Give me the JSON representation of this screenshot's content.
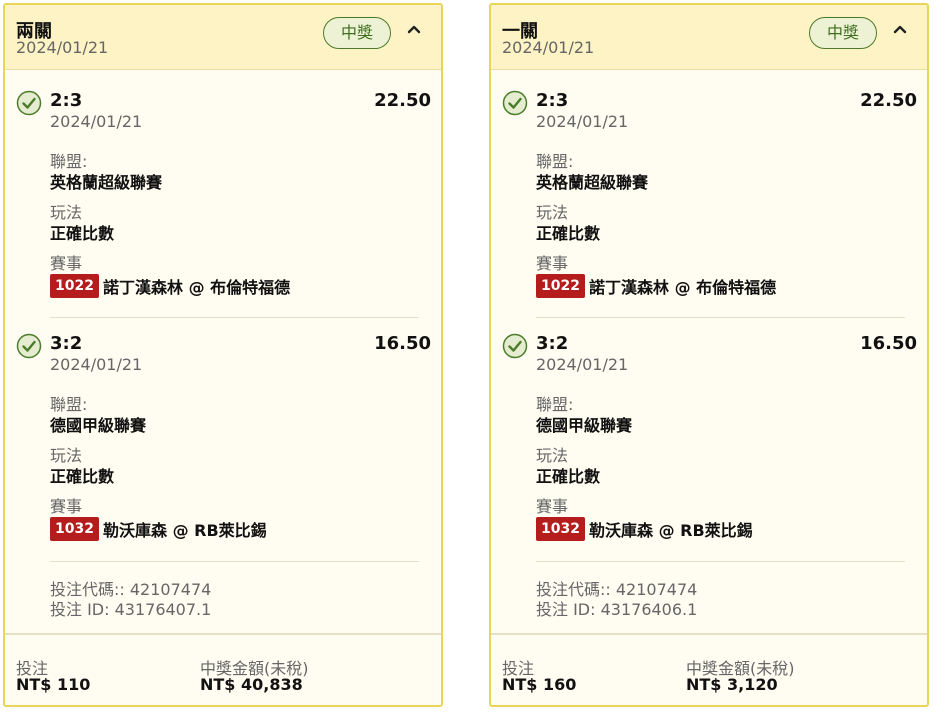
{
  "colors": {
    "header_bg": "#fdf3c4",
    "card_bg": "#fffdf2",
    "card_border": "#e8d55a",
    "win_badge_border": "#4c7a2a",
    "check_green": "#4a7d2a",
    "event_code_bg": "#b51c1c"
  },
  "bets": [
    {
      "title": "兩關",
      "date": "2024/01/21",
      "status": "中獎",
      "collapse_icon": "chevron-up-icon",
      "legs": [
        {
          "score": "2:3",
          "odds": "22.50",
          "date": "2024/01/21",
          "league_label": "聯盟:",
          "league": "英格蘭超級聯賽",
          "play_label": "玩法",
          "play": "正確比數",
          "event_label": "賽事",
          "event_code": "1022",
          "event_name": "諾丁漢森林 @ 布倫特福德"
        },
        {
          "score": "3:2",
          "odds": "16.50",
          "date": "2024/01/21",
          "league_label": "聯盟:",
          "league": "德國甲級聯賽",
          "play_label": "玩法",
          "play": "正確比數",
          "event_label": "賽事",
          "event_code": "1032",
          "event_name": "勒沃庫森 @ RB萊比錫"
        }
      ],
      "bet_code": "投注代碼:: 42107474",
      "bet_id": "投注 ID: 43176407.1",
      "stake_label": "投注",
      "stake": "NT$ 110",
      "payout_label": "中獎金額(未稅)",
      "payout": "NT$ 40,838"
    },
    {
      "title": "一關",
      "date": "2024/01/21",
      "status": "中獎",
      "collapse_icon": "chevron-up-icon",
      "legs": [
        {
          "score": "2:3",
          "odds": "22.50",
          "date": "2024/01/21",
          "league_label": "聯盟:",
          "league": "英格蘭超級聯賽",
          "play_label": "玩法",
          "play": "正確比數",
          "event_label": "賽事",
          "event_code": "1022",
          "event_name": "諾丁漢森林 @ 布倫特福德"
        },
        {
          "score": "3:2",
          "odds": "16.50",
          "date": "2024/01/21",
          "league_label": "聯盟:",
          "league": "德國甲級聯賽",
          "play_label": "玩法",
          "play": "正確比數",
          "event_label": "賽事",
          "event_code": "1032",
          "event_name": "勒沃庫森 @ RB萊比錫"
        }
      ],
      "bet_code": "投注代碼:: 42107474",
      "bet_id": "投注 ID: 43176406.1",
      "stake_label": "投注",
      "stake": "NT$ 160",
      "payout_label": "中獎金額(未稅)",
      "payout": "NT$ 3,120"
    }
  ]
}
